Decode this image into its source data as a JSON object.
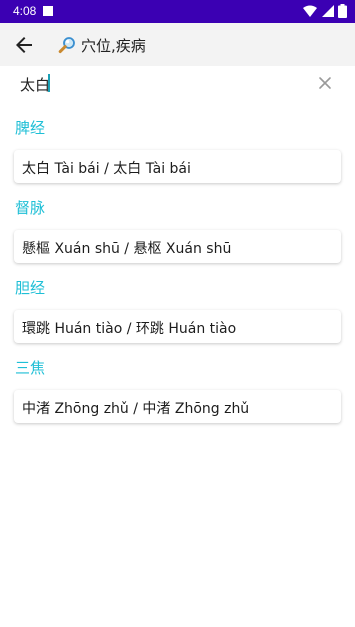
{
  "status_bar": {
    "time": "4:08",
    "color": "#3b00b3"
  },
  "app_bar": {
    "title": "穴位,疾病",
    "back_icon": "arrow-back-icon",
    "title_icon": "magnifier-icon"
  },
  "search": {
    "value": "太白",
    "clear_icon": "close-icon"
  },
  "results": [
    {
      "group": "脾经",
      "text": "太白 Tài bái / 太白 Tài bái"
    },
    {
      "group": "督脉",
      "text": "懸樞 Xuán shū / 悬枢 Xuán shū"
    },
    {
      "group": "胆经",
      "text": "環跳 Huán tiào / 环跳 Huán tiào"
    },
    {
      "group": "三焦",
      "text": "中渚 Zhōng zhǔ / 中渚 Zhōng zhǔ"
    }
  ],
  "colors": {
    "accent": "#1fbfd6"
  }
}
